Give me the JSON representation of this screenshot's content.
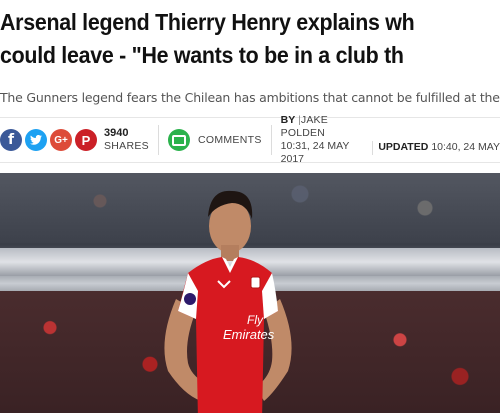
{
  "article": {
    "headline_line1": "Arsenal legend Thierry Henry explains wh",
    "headline_line2": "could leave - \"He wants to be in a club th",
    "subheadline": "The Gunners legend fears the Chilean has ambitions that cannot be fulfilled at the club"
  },
  "share": {
    "count": "3940",
    "count_label": "SHARES",
    "icons": [
      "facebook-icon",
      "twitter-icon",
      "google-plus-icon",
      "pinterest-icon"
    ],
    "glyphs": {
      "facebook": "f",
      "twitter": "t",
      "googleplus": "G+",
      "pinterest": "P"
    },
    "colors": {
      "facebook": "#3b5998",
      "twitter": "#1da1f2",
      "googleplus": "#dd4b39",
      "pinterest": "#cb2027",
      "comments": "#2bb24c"
    }
  },
  "comments": {
    "label": "COMMENTS"
  },
  "byline": {
    "by": "BY",
    "author": "JAKE POLDEN",
    "published": "10:31, 24 MAY 2017"
  },
  "updated": {
    "label": "UPDATED",
    "value": "10:40, 24 MAY"
  },
  "photo": {
    "shirt_sponsor_line1": "Fly",
    "shirt_sponsor_line2": "Emirates",
    "colors": {
      "shirt": "#d71920",
      "sleeve": "#ffffff"
    }
  }
}
